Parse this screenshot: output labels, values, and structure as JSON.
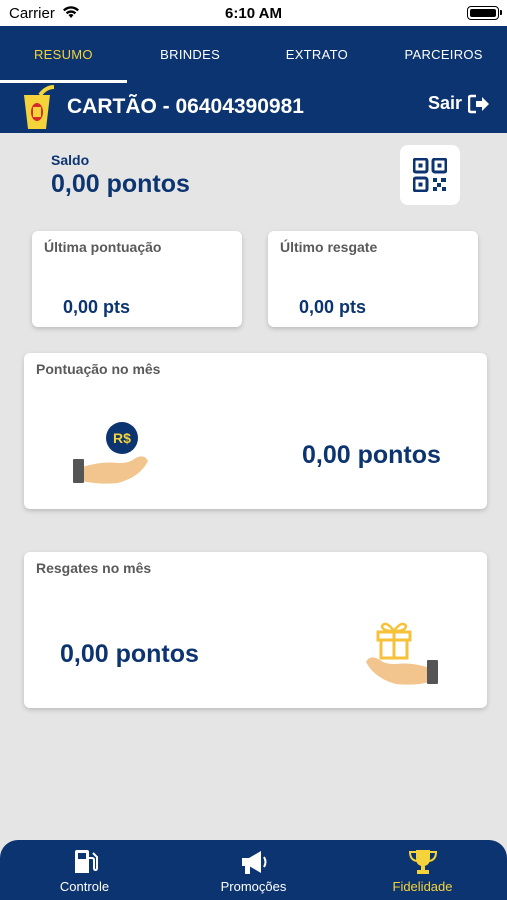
{
  "status_bar": {
    "carrier": "Carrier",
    "time": "6:10 AM"
  },
  "tabs": [
    {
      "label": "RESUMO",
      "active": true
    },
    {
      "label": "BRINDES",
      "active": false
    },
    {
      "label": "EXTRATO",
      "active": false
    },
    {
      "label": "PARCEIROS",
      "active": false
    }
  ],
  "header": {
    "card_title": "CARTÃO - 06404390981",
    "logout_label": "Sair"
  },
  "balance": {
    "label": "Saldo",
    "value": "0,00 pontos"
  },
  "last_points": {
    "title": "Última pontuação",
    "value": "0,00 pts"
  },
  "last_redeem": {
    "title": "Último resgate",
    "value": "0,00 pts"
  },
  "month_points": {
    "title": "Pontuação no mês",
    "value": "0,00 pontos",
    "coin_label": "R$"
  },
  "month_redeem": {
    "title": "Resgates no mês",
    "value": "0,00 pontos"
  },
  "bottom_nav": [
    {
      "label": "Controle",
      "icon": "fuel-pump-icon",
      "active": false
    },
    {
      "label": "Promoções",
      "icon": "megaphone-icon",
      "active": false
    },
    {
      "label": "Fidelidade",
      "icon": "trophy-icon",
      "active": true
    }
  ],
  "colors": {
    "primary": "#0c3470",
    "accent": "#f5d33a",
    "background": "#e5e5e5"
  }
}
